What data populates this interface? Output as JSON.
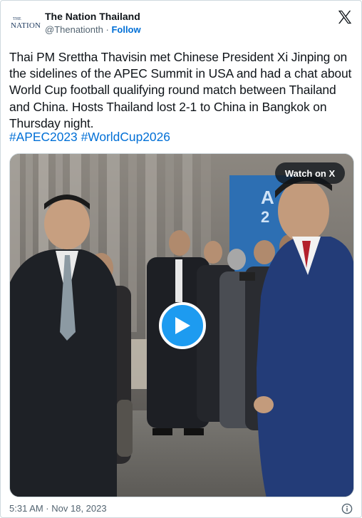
{
  "author": {
    "display_name": "The Nation Thailand",
    "handle": "@Thenationth",
    "separator": "·",
    "follow_label": "Follow",
    "avatar_small": "THE",
    "avatar_main": "NATION"
  },
  "tweet": {
    "text": "Thai PM Srettha Thavisin met Chinese President Xi Jinping on the sidelines of the APEC Summit in USA and had a chat about World Cup football qualifying round match between Thailand and China. Hosts Thailand lost 2-1 to China in Bangkok on Thursday night.",
    "hashtags": [
      "#APEC2023",
      "#WorldCup2026"
    ]
  },
  "media": {
    "watch_label": "Watch on X",
    "screen_text": [
      "A",
      "2"
    ]
  },
  "footer": {
    "timestamp": "5:31 AM · Nov 18, 2023"
  },
  "colors": {
    "link": "#006fd6",
    "play_button": "#1d9bf0",
    "border": "#cfd9de",
    "muted": "#536471"
  },
  "icons": [
    "x-logo-icon",
    "play-icon",
    "info-icon"
  ]
}
